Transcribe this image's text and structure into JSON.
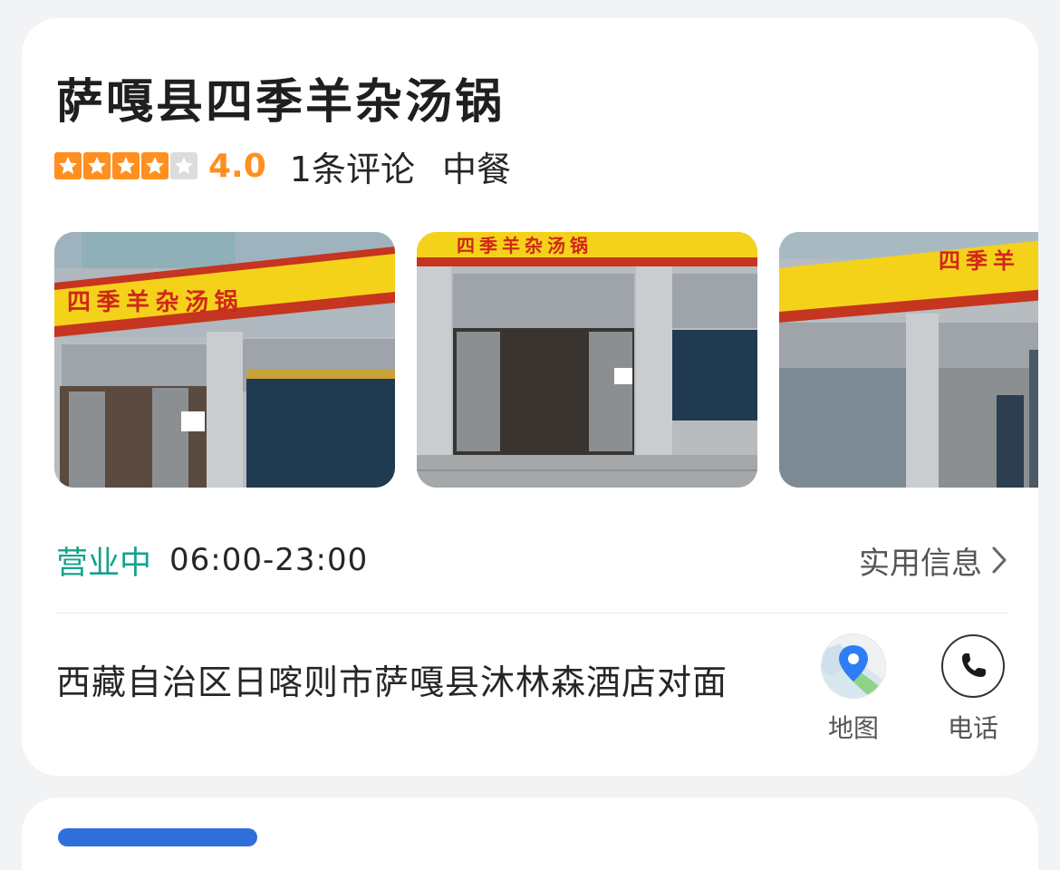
{
  "poi": {
    "name": "萨嘎县四季羊杂汤锅",
    "rating": 4.0,
    "rating_display": "4.0",
    "review_count": "1条评论",
    "category": "中餐"
  },
  "photos": [
    {
      "alt": "storefront-photo-1"
    },
    {
      "alt": "storefront-photo-2"
    },
    {
      "alt": "storefront-photo-3"
    }
  ],
  "hours": {
    "status": "营业中",
    "time": "06:00-23:00",
    "info_link": "实用信息"
  },
  "address": {
    "text": "西藏自治区日喀则市萨嘎县沐林森酒店对面"
  },
  "actions": {
    "map_label": "地图",
    "phone_label": "电话"
  },
  "colors": {
    "star_filled": "#ff8f1f",
    "star_empty": "#dcdcdc",
    "score": "#ff8f1f",
    "open_status": "#14a38b",
    "accent_blue": "#2f6fdc"
  },
  "icons": {
    "star": "star-icon",
    "chevron": "chevron-right-icon",
    "map": "map-pin-icon",
    "phone": "phone-icon"
  }
}
